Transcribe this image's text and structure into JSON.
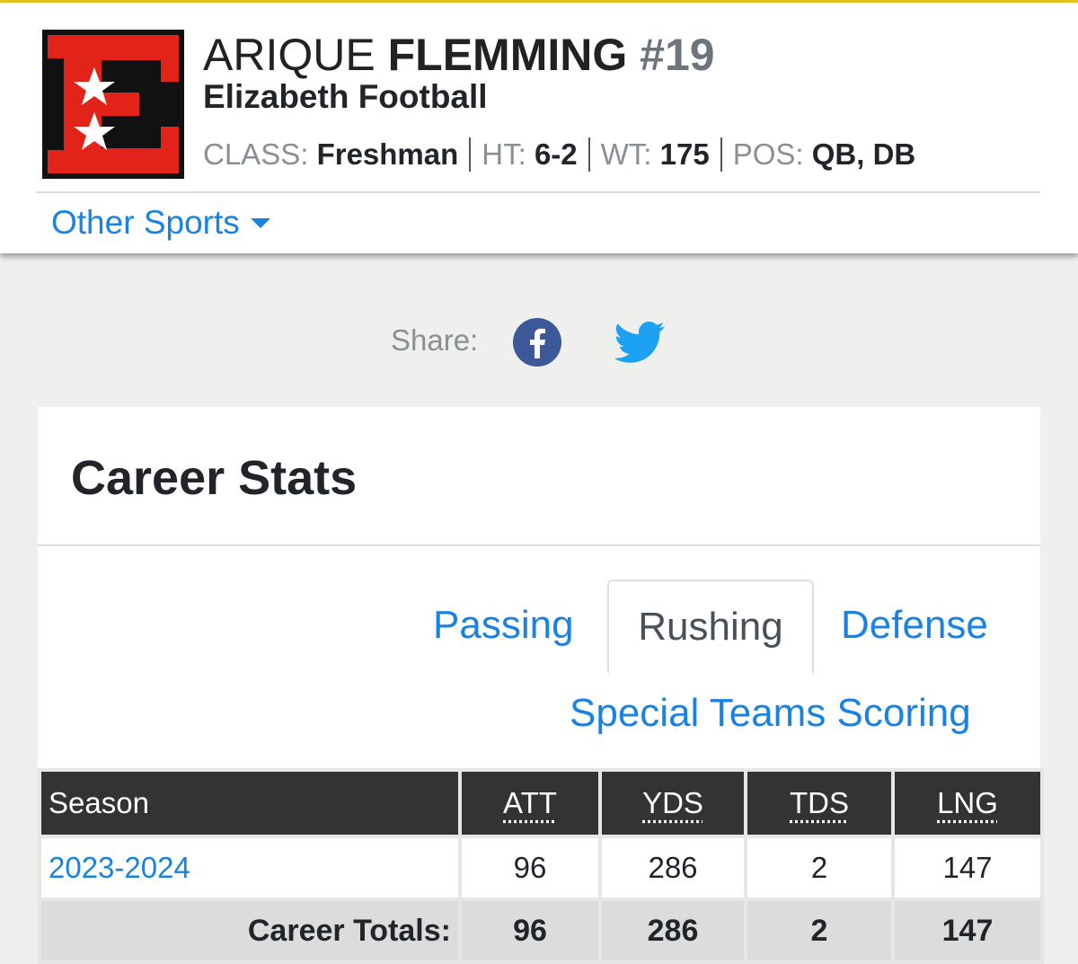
{
  "player": {
    "first_name": "ARIQUE",
    "last_name": "FLEMMING",
    "number": "#19",
    "team": "Elizabeth Football",
    "logo_letter": "E",
    "meta": {
      "class_label": "CLASS:",
      "class_value": "Freshman",
      "ht_label": "HT:",
      "ht_value": "6-2",
      "wt_label": "WT:",
      "wt_value": "175",
      "pos_label": "POS:",
      "pos_value": "QB, DB"
    }
  },
  "other_sports": {
    "label": "Other Sports",
    "icon": "caret-down-icon"
  },
  "share": {
    "label": "Share:",
    "facebook_icon": "facebook-icon",
    "twitter_icon": "twitter-icon"
  },
  "career_stats": {
    "title": "Career Stats",
    "tabs": {
      "passing": "Passing",
      "rushing": "Rushing",
      "defense": "Defense",
      "special_teams": "Special Teams Scoring"
    },
    "active_tab": "Rushing",
    "columns": [
      "Season",
      "ATT",
      "YDS",
      "TDS",
      "LNG"
    ],
    "rows": [
      {
        "season": "2023-2024",
        "att": "96",
        "yds": "286",
        "tds": "2",
        "lng": "147"
      }
    ],
    "totals": {
      "label": "Career Totals:",
      "att": "96",
      "yds": "286",
      "tds": "2",
      "lng": "147"
    }
  },
  "colors": {
    "accent": "#1a82e0",
    "logo_red": "#e2231a",
    "facebook": "#3b5998",
    "twitter": "#1da1f2",
    "top_bar": "#e8c21e"
  }
}
